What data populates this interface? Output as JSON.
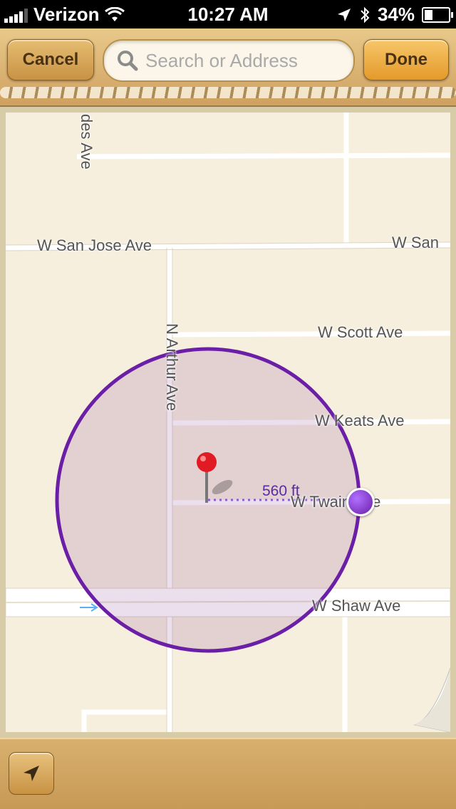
{
  "status_bar": {
    "carrier": "Verizon",
    "time": "10:27 AM",
    "battery": "34%",
    "battery_level": 0.34,
    "icons": [
      "signal-icon",
      "wifi-icon",
      "location-arrow-icon",
      "bluetooth-icon",
      "battery-icon"
    ]
  },
  "toolbar": {
    "cancel_label": "Cancel",
    "done_label": "Done",
    "search_placeholder": "Search or Address",
    "search_value": ""
  },
  "map": {
    "streets": {
      "top_cut": "des Ave",
      "san_jose": "W San Jose Ave",
      "san_jose_right": "W San",
      "scott": "W Scott Ave",
      "arthur": "N Arthur Ave",
      "keats": "W Keats Ave",
      "twain": "W Twain Ave",
      "shaw": "W Shaw Ave"
    },
    "geofence_radius_label": "560 ft",
    "colors": {
      "geofence": "#6a1fa6",
      "pin": "#e01b24",
      "map_bg": "#f6efde"
    }
  },
  "bottom_bar": {
    "current_location_icon": "location-arrow-icon"
  }
}
